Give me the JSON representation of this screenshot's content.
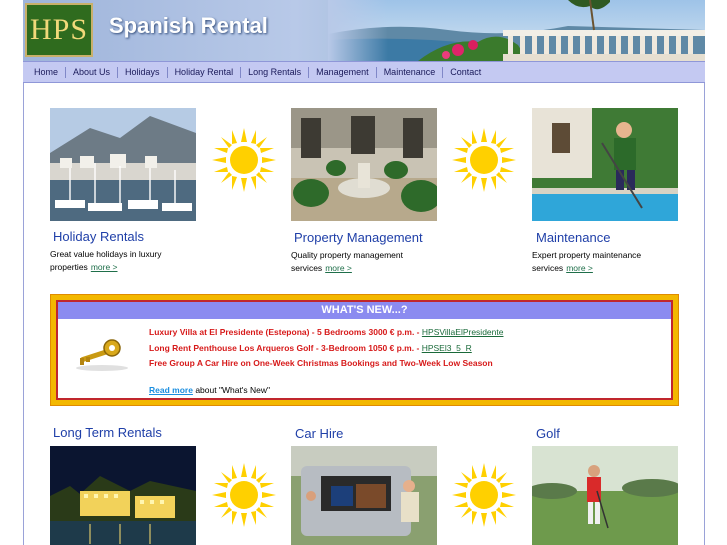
{
  "header": {
    "logo_text": "HPS",
    "site_title": "Spanish Rental"
  },
  "nav": [
    {
      "label": "Home"
    },
    {
      "label": "About Us"
    },
    {
      "label": "Holidays"
    },
    {
      "label": "Holiday Rental"
    },
    {
      "label": "Long Rentals"
    },
    {
      "label": "Management"
    },
    {
      "label": "Maintenance"
    },
    {
      "label": "Contact"
    }
  ],
  "sections": {
    "holiday": {
      "title": "Holiday Rentals",
      "desc": "Great value holidays in luxury properties",
      "more": "more >"
    },
    "management": {
      "title": "Property Management",
      "desc": "Quality property management services",
      "more": "more >"
    },
    "maintenance": {
      "title": "Maintenance",
      "desc": "Expert property maintenance services",
      "more": "more >"
    },
    "long_term": {
      "title": "Long Term Rentals"
    },
    "car_hire": {
      "title": "Car Hire"
    },
    "golf": {
      "title": "Golf"
    }
  },
  "news": {
    "heading": "WHAT'S NEW...?",
    "item1_text": "Luxury Villa at El Presidente (Estepona) - 5 Bedrooms 3000 € p.m.  -",
    "item1_link": "HPSVillaElPresidente",
    "item2_text": "Long Rent Penthouse Los Arqueros Golf  - 3-Bedroom 1050 € p.m.  -",
    "item2_link": "HPSEl3_5_R",
    "item3_text": "Free Group A Car Hire on One-Week Christmas Bookings and Two-Week Low Season",
    "read_more_link": "Read more",
    "read_more_suffix": "about \"What's New\""
  },
  "colors": {
    "nav_bg": "#c4c9f2",
    "title_blue": "#1f3fa8",
    "news_red": "#d71a1a",
    "news_border": "#f3b800",
    "news_head": "#8b8bf0"
  }
}
